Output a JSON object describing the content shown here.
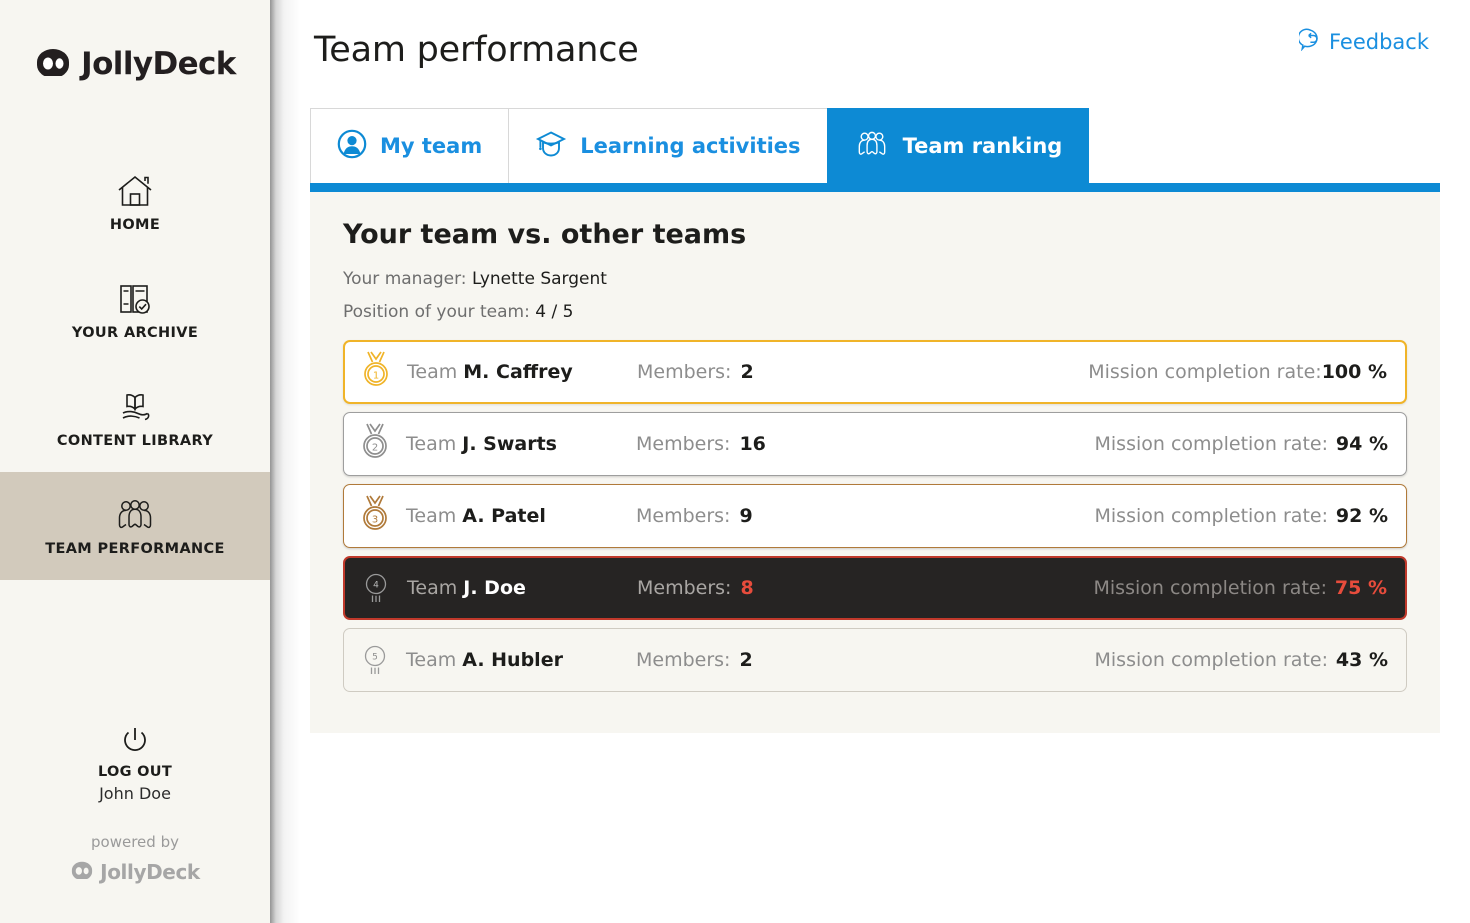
{
  "sidebar": {
    "brand": {
      "text": "JollyDeck",
      "icon": "jollydeck-logo-icon"
    },
    "items": [
      {
        "label": "HOME",
        "icon": "home-icon",
        "active": false
      },
      {
        "label": "YOUR ARCHIVE",
        "icon": "archive-icon",
        "active": false
      },
      {
        "label": "CONTENT LIBRARY",
        "icon": "book-hand-icon",
        "active": false
      },
      {
        "label": "TEAM PERFORMANCE",
        "icon": "team-icon",
        "active": true
      }
    ],
    "logout": {
      "label": "LOG OUT",
      "user": "John Doe",
      "icon": "power-icon"
    },
    "powered": {
      "text": "powered by",
      "brand": "JollyDeck"
    }
  },
  "header": {
    "title": "Team performance",
    "feedback": {
      "label": "Feedback",
      "icon": "feedback-bubble-icon"
    }
  },
  "tabs": [
    {
      "label": "My team",
      "icon": "person-circle-icon",
      "active": false
    },
    {
      "label": "Learning activities",
      "icon": "graduation-cap-icon",
      "active": false
    },
    {
      "label": "Team ranking",
      "icon": "team-group-icon",
      "active": true
    }
  ],
  "panel": {
    "title": "Your team vs. other teams",
    "manager_label": "Your manager: ",
    "manager_name": "Lynette Sargent",
    "position_label": "Position of your team: ",
    "position_value": "4 / 5",
    "members_label": "Members:",
    "rate_label": "Mission completion rate:"
  },
  "ranking": [
    {
      "rank": "1",
      "team_prefix": "Team ",
      "team_name": "M. Caffrey",
      "members": "2",
      "rate": "100 %",
      "style": "gold",
      "badge": "gold-medal-icon"
    },
    {
      "rank": "2",
      "team_prefix": "Team ",
      "team_name": "J. Swarts",
      "members": "16",
      "rate": "94 %",
      "style": "silver",
      "badge": "silver-medal-icon"
    },
    {
      "rank": "3",
      "team_prefix": "Team ",
      "team_name": "A. Patel",
      "members": "9",
      "rate": "92 %",
      "style": "bronze",
      "badge": "bronze-medal-icon"
    },
    {
      "rank": "4",
      "team_prefix": "Team ",
      "team_name": "J. Doe",
      "members": "8",
      "rate": "75 %",
      "style": "me",
      "badge": "rank-circle-icon"
    },
    {
      "rank": "5",
      "team_prefix": "Team ",
      "team_name": "A. Hubler",
      "members": "2",
      "rate": "43 %",
      "style": "plain",
      "badge": "rank-circle-icon"
    }
  ],
  "colors": {
    "accent_blue": "#0d8ad4",
    "sidebar_bg": "#f7f6f1",
    "sidebar_active": "#d2cabc",
    "panel_bg": "#f7f6f1",
    "gold": "#f0b429",
    "silver": "#9e9e9e",
    "bronze": "#b07a3a",
    "danger_red": "#e74c3c",
    "me_row_bg": "#262423"
  }
}
